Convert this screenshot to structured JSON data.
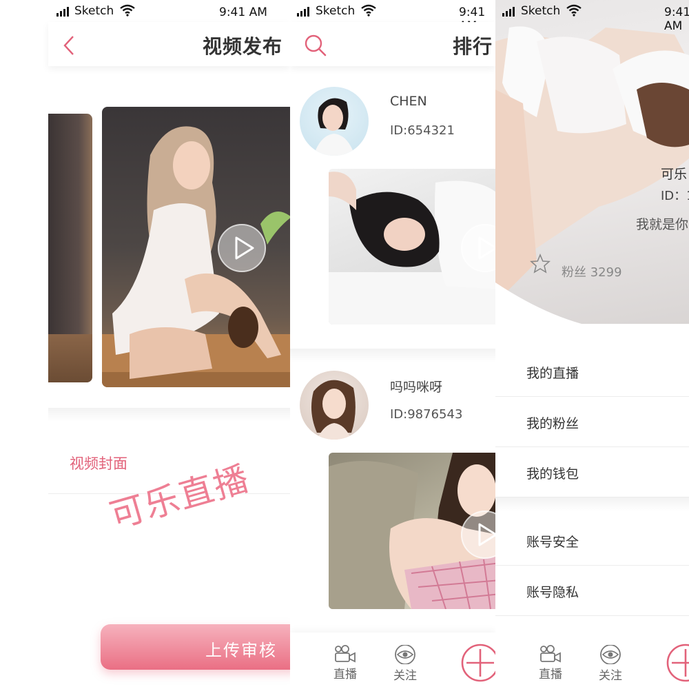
{
  "status_bar": {
    "carrier": "Sketch",
    "time": "9:41 AM"
  },
  "colors": {
    "accent": "#e2627a",
    "button_top": "#f6b2bd",
    "button_bottom": "#ea6f84",
    "text": "#333333"
  },
  "screen1": {
    "title": "视频发布",
    "cover_label": "视频封面",
    "watermark": "可乐直播",
    "upload_button": "上传审核",
    "icons": {
      "back": "chevron-left-icon",
      "play": "play-icon"
    }
  },
  "screen2": {
    "title": "排行",
    "entries": [
      {
        "name": "CHEN",
        "id": "ID:654321"
      },
      {
        "name": "吗吗咪呀",
        "id": "ID:9876543"
      }
    ],
    "icons": {
      "search": "search-icon"
    },
    "tabs": [
      {
        "label": "直播",
        "icon": "camera-icon"
      },
      {
        "label": "关注",
        "icon": "eye-icon"
      }
    ]
  },
  "screen3": {
    "name": "可乐",
    "id": "ID：1",
    "signature": "我就是你",
    "fans": "粉丝 3299",
    "menu": [
      "我的直播",
      "我的粉丝",
      "我的钱包",
      "账号安全",
      "账号隐私"
    ],
    "tabs": [
      {
        "label": "直播",
        "icon": "camera-icon"
      },
      {
        "label": "关注",
        "icon": "eye-icon"
      }
    ]
  }
}
